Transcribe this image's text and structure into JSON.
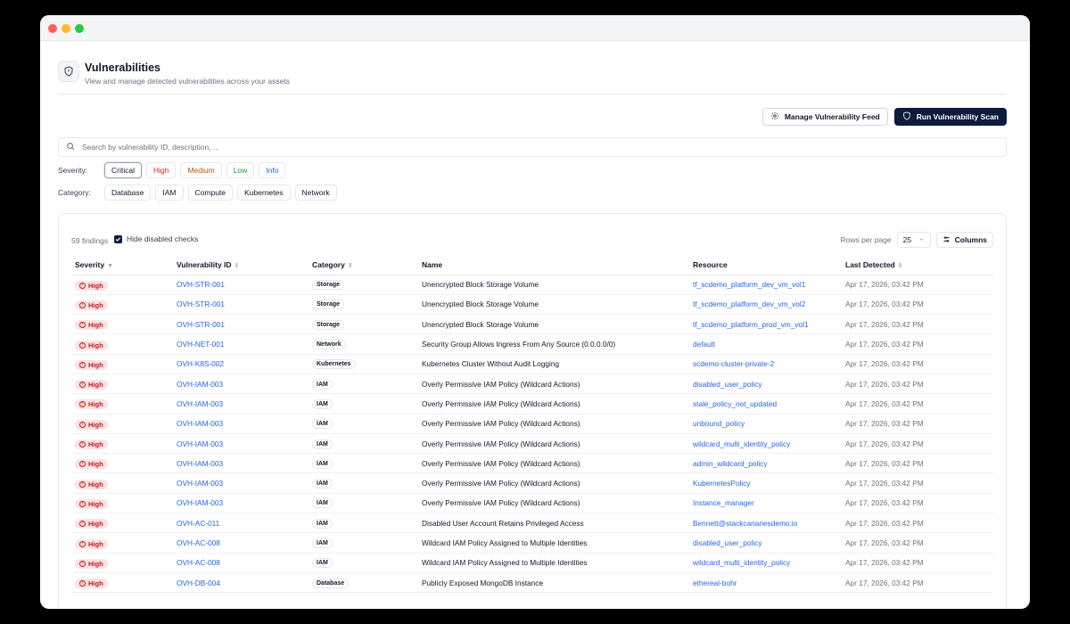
{
  "header": {
    "title": "Vulnerabilities",
    "subtitle": "View and manage detected vulnerabilities across your assets"
  },
  "actions": {
    "manage_feed": "Manage Vulnerability Feed",
    "run_scan": "Run Vulnerability Scan"
  },
  "search": {
    "placeholder": "Search by vulnerability ID, description, ..."
  },
  "filters": {
    "severity_label": "Severity:",
    "severity": [
      "Critical",
      "High",
      "Medium",
      "Low",
      "Info"
    ],
    "severity_colors": [
      "#111827",
      "#dc2626",
      "#b45309",
      "#16a34a",
      "#2563eb"
    ],
    "category_label": "Category:",
    "category": [
      "Database",
      "IAM",
      "Compute",
      "Kubernetes",
      "Network"
    ]
  },
  "table_controls": {
    "findings": "59 findings",
    "hide_disabled": "Hide disabled checks",
    "rows_per_page_label": "Rows per page",
    "rows_per_page": "25",
    "columns": "Columns"
  },
  "columns": [
    "Severity",
    "Vulnerability ID",
    "Category",
    "Name",
    "Resource",
    "Last Detected"
  ],
  "rows": [
    {
      "severity": "High",
      "id": "OVH-STR-001",
      "category": "Storage",
      "name": "Unencrypted Block Storage Volume",
      "resource": "tf_scdemo_platform_dev_vm_vol1",
      "detected": "Apr 17, 2026, 03:42 PM"
    },
    {
      "severity": "High",
      "id": "OVH-STR-001",
      "category": "Storage",
      "name": "Unencrypted Block Storage Volume",
      "resource": "tf_scdemo_platform_dev_vm_vol2",
      "detected": "Apr 17, 2026, 03:42 PM"
    },
    {
      "severity": "High",
      "id": "OVH-STR-001",
      "category": "Storage",
      "name": "Unencrypted Block Storage Volume",
      "resource": "tf_scdemo_platform_prod_vm_vol1",
      "detected": "Apr 17, 2026, 03:42 PM"
    },
    {
      "severity": "High",
      "id": "OVH-NET-001",
      "category": "Network",
      "name": "Security Group Allows Ingress From Any Source (0.0.0.0/0)",
      "resource": "default",
      "detected": "Apr 17, 2026, 03:42 PM"
    },
    {
      "severity": "High",
      "id": "OVH-K8S-002",
      "category": "Kubernetes",
      "name": "Kubernetes Cluster Without Audit Logging",
      "resource": "scdemo-cluster-private-2",
      "detected": "Apr 17, 2026, 03:42 PM"
    },
    {
      "severity": "High",
      "id": "OVH-IAM-003",
      "category": "IAM",
      "name": "Overly Permissive IAM Policy (Wildcard Actions)",
      "resource": "disabled_user_policy",
      "detected": "Apr 17, 2026, 03:42 PM"
    },
    {
      "severity": "High",
      "id": "OVH-IAM-003",
      "category": "IAM",
      "name": "Overly Permissive IAM Policy (Wildcard Actions)",
      "resource": "stale_policy_not_updated",
      "detected": "Apr 17, 2026, 03:42 PM"
    },
    {
      "severity": "High",
      "id": "OVH-IAM-003",
      "category": "IAM",
      "name": "Overly Permissive IAM Policy (Wildcard Actions)",
      "resource": "unbound_policy",
      "detected": "Apr 17, 2026, 03:42 PM"
    },
    {
      "severity": "High",
      "id": "OVH-IAM-003",
      "category": "IAM",
      "name": "Overly Permissive IAM Policy (Wildcard Actions)",
      "resource": "wildcard_multi_identity_policy",
      "detected": "Apr 17, 2026, 03:42 PM"
    },
    {
      "severity": "High",
      "id": "OVH-IAM-003",
      "category": "IAM",
      "name": "Overly Permissive IAM Policy (Wildcard Actions)",
      "resource": "admin_wildcard_policy",
      "detected": "Apr 17, 2026, 03:42 PM"
    },
    {
      "severity": "High",
      "id": "OVH-IAM-003",
      "category": "IAM",
      "name": "Overly Permissive IAM Policy (Wildcard Actions)",
      "resource": "KubernetesPolicy",
      "detected": "Apr 17, 2026, 03:42 PM"
    },
    {
      "severity": "High",
      "id": "OVH-IAM-003",
      "category": "IAM",
      "name": "Overly Permissive IAM Policy (Wildcard Actions)",
      "resource": "Instance_manager",
      "detected": "Apr 17, 2026, 03:42 PM"
    },
    {
      "severity": "High",
      "id": "OVH-AC-011",
      "category": "IAM",
      "name": "Disabled User Account Retains Privileged Access",
      "resource": "Bennett@stackcanariesdemo.io",
      "detected": "Apr 17, 2026, 03:42 PM"
    },
    {
      "severity": "High",
      "id": "OVH-AC-008",
      "category": "IAM",
      "name": "Wildcard IAM Policy Assigned to Multiple Identities",
      "resource": "disabled_user_policy",
      "detected": "Apr 17, 2026, 03:42 PM"
    },
    {
      "severity": "High",
      "id": "OVH-AC-008",
      "category": "IAM",
      "name": "Wildcard IAM Policy Assigned to Multiple Identities",
      "resource": "wildcard_multi_identity_policy",
      "detected": "Apr 17, 2026, 03:42 PM"
    },
    {
      "severity": "High",
      "id": "OVH-DB-004",
      "category": "Database",
      "name": "Publicly Exposed MongoDB Instance",
      "resource": "ethereal-bohr",
      "detected": "Apr 17, 2026, 03:42 PM"
    }
  ]
}
